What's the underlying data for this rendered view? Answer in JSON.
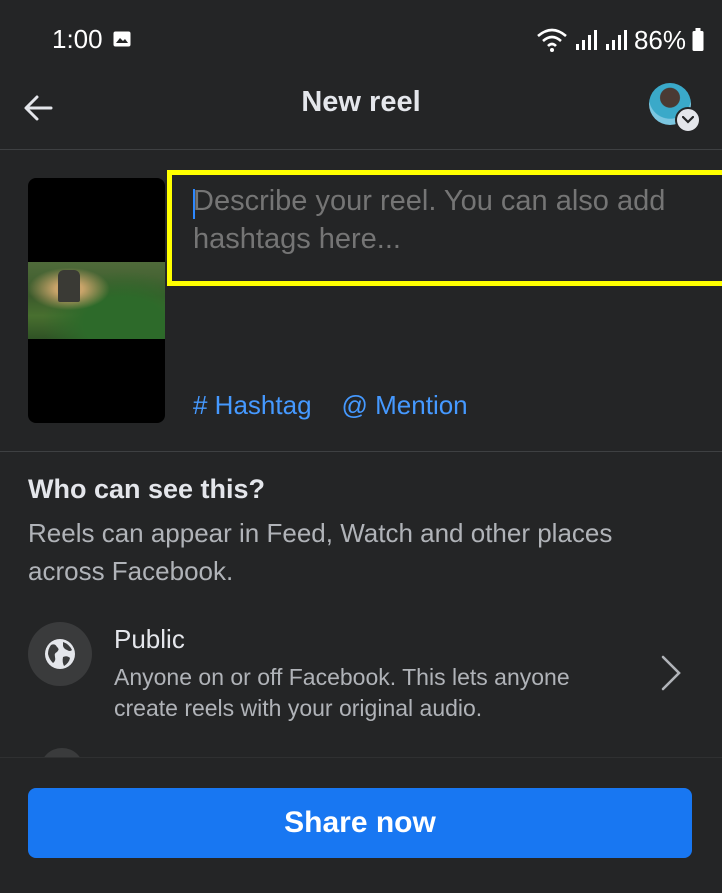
{
  "status_bar": {
    "time": "1:00",
    "battery": "86%",
    "icons": [
      "gallery-icon",
      "wifi-icon",
      "signal-icon",
      "signal-icon",
      "battery-icon"
    ]
  },
  "header": {
    "title": "New reel",
    "back_icon": "arrow-left-icon",
    "avatar_icon": "avatar"
  },
  "composer": {
    "caption_placeholder": "Describe your reel. You can also add hashtags here...",
    "hashtag_label": "# Hashtag",
    "mention_label": "@ Mention",
    "highlight_color": "#ffff00"
  },
  "audience": {
    "title": "Who can see this?",
    "description": "Reels can appear in Feed, Watch and other places across Facebook.",
    "option": {
      "label": "Public",
      "description": "Anyone on or off Facebook. This lets anyone create reels with your original audio.",
      "icon": "globe-icon"
    }
  },
  "footer": {
    "share_label": "Share now",
    "accent_color": "#1877f2"
  }
}
